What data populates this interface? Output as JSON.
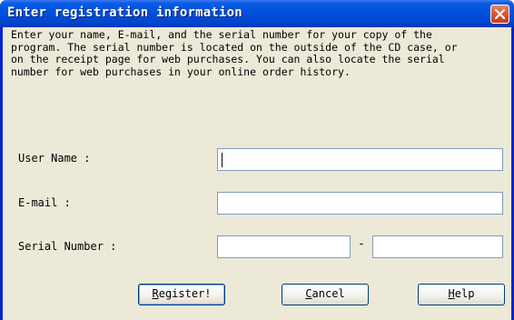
{
  "window": {
    "title": "Enter registration information"
  },
  "instructions": "Enter your name, E-mail, and the serial number for your copy of the\nprogram. The serial number is located on the outside of the CD case, or\non the receipt page for web purchases. You can also locate the serial\nnumber for web purchases in your online order history.",
  "form": {
    "user_name_label": "User Name :",
    "user_name_value": "",
    "email_label": "E-mail :",
    "email_value": "",
    "serial_label": "Serial Number :",
    "serial_part1_value": "",
    "serial_separator": "-",
    "serial_part2_value": ""
  },
  "buttons": {
    "register": {
      "mnemonic": "R",
      "rest": "egister!"
    },
    "cancel": {
      "mnemonic": "C",
      "rest": "ancel"
    },
    "help": {
      "mnemonic": "H",
      "rest": "elp"
    }
  },
  "colors": {
    "titlebar": "#0052dd",
    "client_bg": "#ece9d8",
    "close_button": "#dd5a36",
    "field_border": "#7f9db9"
  }
}
